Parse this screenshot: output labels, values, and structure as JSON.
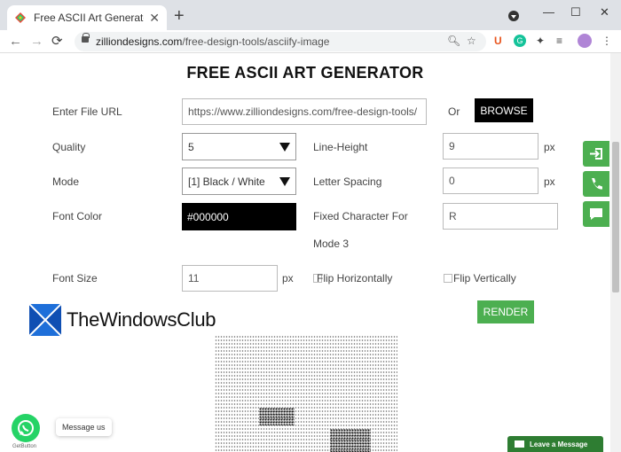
{
  "browser": {
    "tab_title": "Free ASCII Art Generator by Zillio",
    "url_host": "zilliondesigns.com",
    "url_path": "/free-design-tools/asciify-image"
  },
  "page": {
    "title": "FREE ASCII ART GENERATOR",
    "file_url_label": "Enter File URL",
    "file_url_value": "https://www.zilliondesigns.com/free-design-tools/",
    "or_label": "Or",
    "browse_label": "BROWSE",
    "quality_label": "Quality",
    "quality_value": "5",
    "line_height_label": "Line-Height",
    "line_height_value": "9",
    "line_height_unit": "px",
    "mode_label": "Mode",
    "mode_value": "[1] Black / White",
    "letter_spacing_label": "Letter Spacing",
    "letter_spacing_value": "0",
    "letter_spacing_unit": "px",
    "font_color_label": "Font Color",
    "font_color_value": "#000000",
    "fixed_char_label_1": "Fixed Character For",
    "fixed_char_label_2": "Mode 3",
    "fixed_char_value": "R",
    "font_size_label": "Font Size",
    "font_size_value": "11",
    "font_size_unit": "px",
    "flip_h_label": "Flip Horizontally",
    "flip_v_label": "Flip Vertically",
    "render_label": "RENDER"
  },
  "watermark": {
    "text": "TheWindowsClub"
  },
  "widgets": {
    "message_us": "Message us",
    "getbutton": "GetButton",
    "leave_message": "Leave a Message"
  },
  "colors": {
    "accent_green": "#4caf50",
    "chat_green": "#2e7d32",
    "whatsapp": "#25d366"
  }
}
